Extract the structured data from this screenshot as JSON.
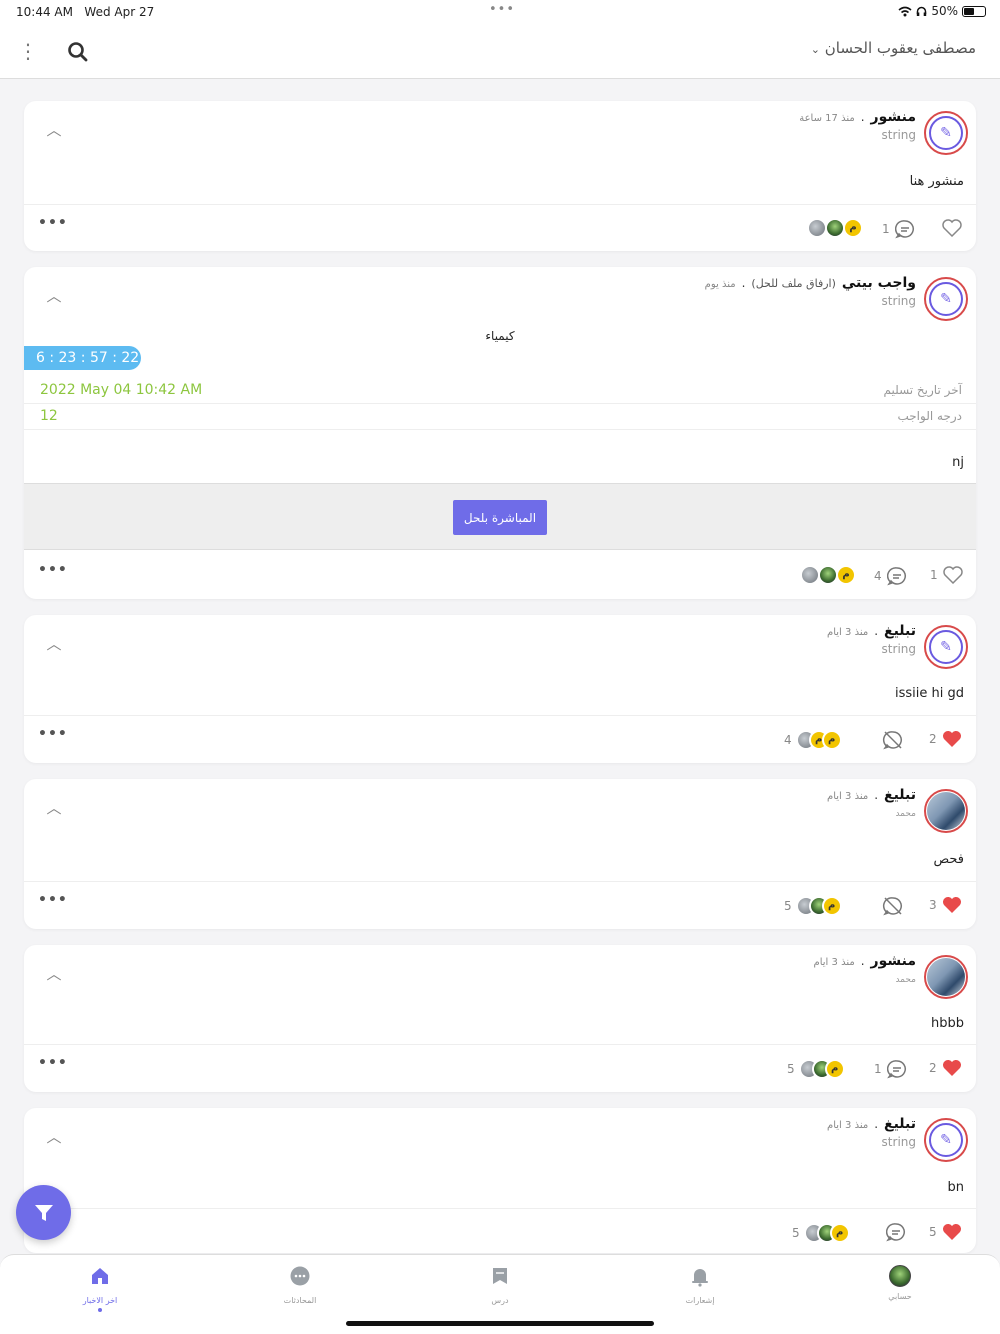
{
  "status": {
    "time": "10:44 AM",
    "date": "Wed Apr 27",
    "battery": "50%",
    "dots": "•••"
  },
  "header": {
    "user_name": "مصطفى يعقوب الحسان",
    "menu_icon": "more-vertical-icon",
    "search_icon": "search-icon"
  },
  "posts": [
    {
      "type": "منشور",
      "extra": "",
      "sep": ".",
      "time": "منذ 17 ساعة",
      "author": "string",
      "body": "منشور هنا",
      "comments": "1",
      "likes": "",
      "liked": false,
      "reactors": "",
      "more": "•••"
    },
    {
      "type": "واجب بيتي",
      "extra": "(ارفاق ملف للحل)",
      "sep": ".",
      "time": "منذ يوم",
      "author": "string",
      "subject": "كيمياء",
      "timer": "6 : 23 : 57 : 22",
      "deadline_value": "2022 May 04   10:42 AM",
      "deadline_label": "آخر تاريخ تسليم",
      "grade_value": "12",
      "grade_label": "درجه الواجب",
      "body": "nj",
      "solve_label": "المباشرة بلحل",
      "comments": "4",
      "likes": "1",
      "liked": false,
      "reactors": "",
      "more": "•••"
    },
    {
      "type": "تبليغ",
      "extra": "",
      "sep": ".",
      "time": "منذ 3 ايام",
      "author": "string",
      "body": "issiie hi gd",
      "comments": "",
      "likes": "2",
      "liked": true,
      "reactors": "4",
      "more": "•••"
    },
    {
      "type": "تبليغ",
      "extra": "",
      "sep": ".",
      "time": "منذ 3 ايام",
      "author": "محمد",
      "body": "فحص",
      "comments": "",
      "likes": "3",
      "liked": true,
      "reactors": "5",
      "more": "•••"
    },
    {
      "type": "منشور",
      "extra": "",
      "sep": ".",
      "time": "منذ 3 ايام",
      "author": "محمد",
      "body": "hbbb",
      "comments": "1",
      "likes": "2",
      "liked": true,
      "reactors": "5",
      "more": "•••"
    },
    {
      "type": "تبليغ",
      "extra": "",
      "sep": ".",
      "time": "منذ 3 ايام",
      "author": "string",
      "body": "bn",
      "comments": "",
      "likes": "5",
      "liked": true,
      "reactors": "5",
      "more": "•••"
    }
  ],
  "tabs": [
    {
      "label": "حسابي",
      "icon": "profile-avatar-icon"
    },
    {
      "label": "إشعارات",
      "icon": "bell-icon"
    },
    {
      "label": "درس",
      "icon": "lesson-icon"
    },
    {
      "label": "المحادثات",
      "icon": "chat-icon"
    },
    {
      "label": "اخر الاخبار",
      "icon": "home-icon"
    }
  ],
  "colors": {
    "accent": "#6f6ce8",
    "like": "#e84a4a",
    "timer": "#5dbbf1",
    "deadline": "#8dc63f"
  }
}
